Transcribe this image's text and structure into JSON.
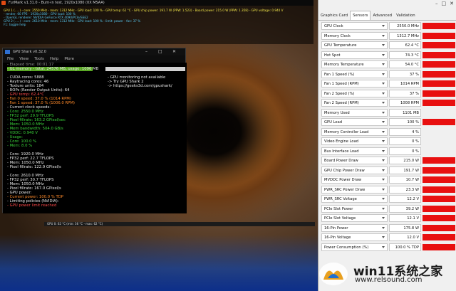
{
  "furmark": {
    "title": "FurMark v1.31.0 - Burn-in test, 1920x1080 (0X MSAA)",
    "lines": [
      {
        "text": "GPU 1 (.....) - core: 2550 MHz - mem: 1312 MHz - GPU load: 100 % - GPU temp: 62 °C - GPU chip power: 191.7 W (PPW: 1.523) - Board power: 215.0 W (PPW: 1.358) - GPU voltage: 0.940 V",
        "color": "#f2e74a"
      },
      {
        "text": "- render: 60 FPS - 1920x1080 - GPU load: 100 %",
        "color": "#58c8f0"
      },
      {
        "text": "- OpenGL renderer: NVIDIA GeForce RTX 4090/PCIe/SSE2",
        "color": "#58c8f0"
      },
      {
        "text": "GPU 2 (.....) - core: 2610 MHz - mem: 1312 MHz - GPU load: 100 % - limit: power - fan: 37 %",
        "color": "#58c8f0"
      },
      {
        "text": "F1: toggle help",
        "color": "#58c8f0"
      }
    ]
  },
  "gpushark": {
    "title": "GPU Shark v0.32.0",
    "menu": [
      "File",
      "View",
      "Tools",
      "Help",
      "More"
    ],
    "left_lines": [
      {
        "text": "- Elapsed time: 00:01:17",
        "color": "#9a9a9a"
      },
      {
        "text": "- GL memory - total: 24576 MB, usage: 1096 MB",
        "color": "#e8e8e8"
      },
      {
        "text": "- CUDA cores: 5888",
        "color": "#e8e8e8"
      },
      {
        "text": "- Raytracing cores: 46",
        "color": "#e8e8e8"
      },
      {
        "text": "- Texture units: 184",
        "color": "#e8e8e8"
      },
      {
        "text": "- ROPs (Render Output Units): 64",
        "color": "#e8e8e8"
      },
      {
        "text": "- GPU temp: 62.4°C",
        "color": "#ff4a4a"
      },
      {
        "text": "- Fan 0 speed: 37.0 % (1014 RPM)",
        "color": "#ff8a2a"
      },
      {
        "text": "- Fan 1 speed: 37.0 % (1006.0 RPM)",
        "color": "#ff8a2a"
      },
      {
        "text": "- Current clock speeds:",
        "color": "#e8e8e8"
      },
      {
        "text": "   - Core: 2550.0 MHz",
        "color": "#3ad23a"
      },
      {
        "text": "   - FP32 perf: 29.9 TFLOPS",
        "color": "#3ad23a"
      },
      {
        "text": "   - Pixel fillrate: 163.2 GPixel/sec",
        "color": "#3ad23a"
      },
      {
        "text": "   - Mem: 1050.0 MHz",
        "color": "#3ad23a"
      },
      {
        "text": "   - Mem bandwidth: 504.0 GB/s",
        "color": "#3ad23a"
      },
      {
        "text": "   - VDDC: 0.940 V",
        "color": "#3ad23a"
      },
      {
        "text": "- Usage:",
        "color": "#3ad23a"
      },
      {
        "text": "   - Core: 100.0 %",
        "color": "#3ad23a"
      },
      {
        "text": "   - Mem: 8.0 %",
        "color": "#3ad23a"
      },
      {
        "text": "",
        "color": "#e8e8e8"
      },
      {
        "text": "   - Core: 1920.0 MHz",
        "color": "#e8e8e8"
      },
      {
        "text": "   - FP32 perf: 22.7 TFLOPS",
        "color": "#e8e8e8"
      },
      {
        "text": "   - Mem: 1050.0 MHz",
        "color": "#e8e8e8"
      },
      {
        "text": "   - Pixel fillrate: 122.9 GPixel/s",
        "color": "#e8e8e8"
      },
      {
        "text": "",
        "color": "#e8e8e8"
      },
      {
        "text": "   - Core: 2610.0 MHz",
        "color": "#e8e8e8"
      },
      {
        "text": "   - FP32 perf: 30.7 TFLOPS",
        "color": "#e8e8e8"
      },
      {
        "text": "   - Mem: 1050.0 MHz",
        "color": "#e8e8e8"
      },
      {
        "text": "   - Pixel fillrate: 167.0 GPixel/s",
        "color": "#e8e8e8"
      },
      {
        "text": "- GPU power:",
        "color": "#e8e8e8"
      },
      {
        "text": "   - Current power: 100.0 % TDP",
        "color": "#ff8a2a"
      },
      {
        "text": "- Limiting policies (NVIDIA):",
        "color": "#e8e8e8"
      },
      {
        "text": "   - GPU power limit reached",
        "color": "#ff4a4a"
      }
    ],
    "right_lines": [
      "- GPU monitoring not available",
      "  -> Try GPU Shark 2",
      "  -> https://geeks3d.com/gpushark/"
    ]
  },
  "graph_label": "GPU 0: 62 °C (min: 36 °C - max: 62 °C)",
  "gpuz": {
    "tabs": [
      "Graphics Card",
      "Sensors",
      "Advanced",
      "Validation"
    ],
    "active_tab": "Sensors",
    "sensors": [
      {
        "label": "GPU Clock",
        "value": "2550.0 MHz",
        "level": 1.0
      },
      {
        "label": "Memory Clock",
        "value": "1312.7 MHz",
        "level": 1.0
      },
      {
        "label": "GPU Temperature",
        "value": "62.4 °C",
        "level": 1.0
      },
      {
        "label": "Hot Spot",
        "value": "74.3 °C",
        "level": 1.0
      },
      {
        "label": "Memory Temperature",
        "value": "54.0 °C",
        "level": 1.0
      },
      {
        "label": "Fan 1 Speed (%)",
        "value": "37 %",
        "level": 1.0
      },
      {
        "label": "Fan 1 Speed (RPM)",
        "value": "1014 RPM",
        "level": 1.0
      },
      {
        "label": "Fan 2 Speed (%)",
        "value": "37 %",
        "level": 1.0
      },
      {
        "label": "Fan 2 Speed (RPM)",
        "value": "1008 RPM",
        "level": 1.0
      },
      {
        "label": "Memory Used",
        "value": "1101 MB",
        "level": 0.0
      },
      {
        "label": "GPU Load",
        "value": "100 %",
        "level": 1.0
      },
      {
        "label": "Memory Controller Load",
        "value": "4 %",
        "level": 0.0
      },
      {
        "label": "Video Engine Load",
        "value": "0 %",
        "level": 0.0
      },
      {
        "label": "Bus Interface Load",
        "value": "0 %",
        "level": 0.0
      },
      {
        "label": "Board Power Draw",
        "value": "215.0 W",
        "level": 1.0
      },
      {
        "label": "GPU Chip Power Draw",
        "value": "191.7 W",
        "level": 1.0
      },
      {
        "label": "MVDDC Power Draw",
        "value": "10.7 W",
        "level": 1.0
      },
      {
        "label": "PWR_SRC Power Draw",
        "value": "23.3 W",
        "level": 1.0
      },
      {
        "label": "PWR_SRC Voltage",
        "value": "12.2 V",
        "level": 1.0
      },
      {
        "label": "PCIe Slot Power",
        "value": "39.2 W",
        "level": 1.0
      },
      {
        "label": "PCIe Slot Voltage",
        "value": "12.1 V",
        "level": 1.0
      },
      {
        "label": "16-Pin Power",
        "value": "175.8 W",
        "level": 1.0
      },
      {
        "label": "16-Pin Voltage",
        "value": "12.0 V",
        "level": 1.0
      },
      {
        "label": "Power Consumption (%)",
        "value": "100.0 % TDP",
        "level": 1.0
      }
    ]
  },
  "watermark": {
    "title": "win11系统之家",
    "url": "www.relsound.com"
  },
  "colors": {
    "sensor_bar": "#e81010",
    "shark_bar": "#5aa825"
  }
}
